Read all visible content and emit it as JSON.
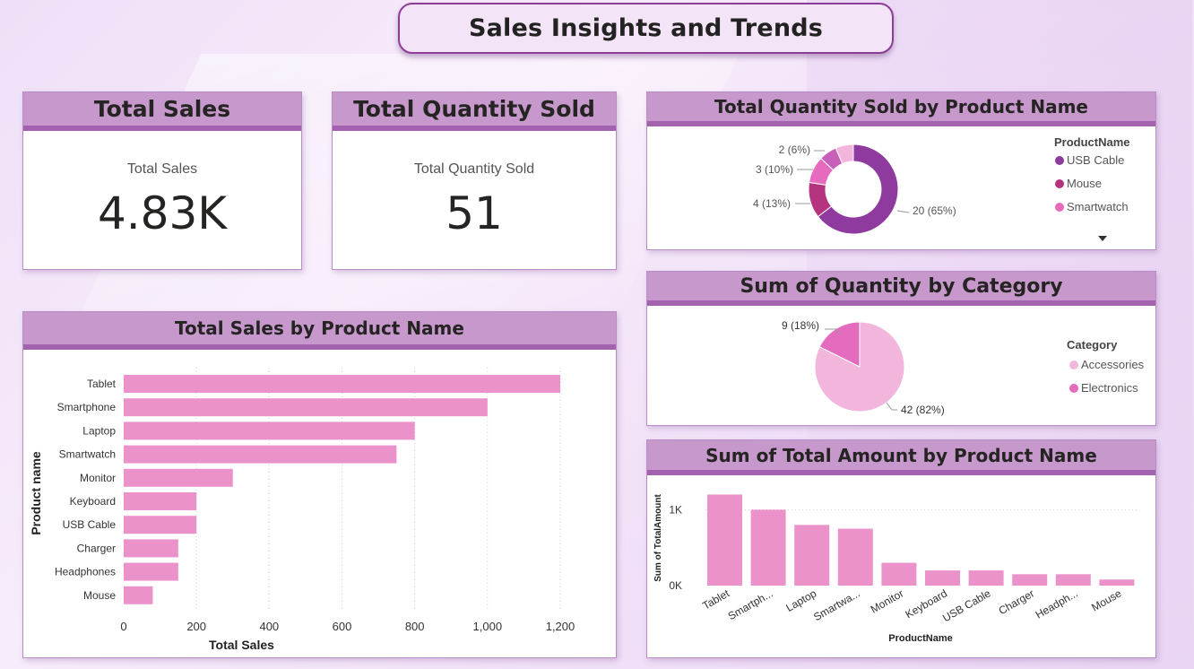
{
  "title": "Sales Insights and Trends",
  "colors": {
    "bar": "#ec92cb",
    "usb": "#8e3a9e",
    "mouse": "#b5347f",
    "smartwatch": "#e66bbf",
    "c4": "#c85fb8",
    "c5": "#f2b6dc",
    "accessories": "#f2b6dc",
    "electronics": "#e46bbd",
    "header": "#c698cc",
    "header_border": "#a262ad"
  },
  "kpis": {
    "sales": {
      "header": "Total Sales",
      "label": "Total Sales",
      "value": "4.83K"
    },
    "qty": {
      "header": "Total Quantity Sold",
      "label": "Total Quantity Sold",
      "value": "51"
    }
  },
  "chart_data": [
    {
      "id": "donut",
      "type": "pie",
      "title": "Total Quantity Sold by Product Name",
      "legend_title": "ProductName",
      "legend_items": [
        "USB Cable",
        "Mouse",
        "Smartwatch"
      ],
      "values": [
        20,
        4,
        3,
        2,
        2
      ],
      "data_labels": [
        "20 (65%)",
        "4 (13%)",
        "3 (10%)",
        "2 (6%)",
        ""
      ],
      "legend_position": "right",
      "more_icon": "caret-down-icon"
    },
    {
      "id": "pie",
      "type": "pie",
      "title": "Sum of Quantity by Category",
      "legend_title": "Category",
      "categories": [
        "Accessories",
        "Electronics"
      ],
      "values": [
        42,
        9
      ],
      "data_labels": [
        "42 (82%)",
        "9 (18%)"
      ],
      "legend_position": "right"
    },
    {
      "id": "hbar",
      "type": "bar",
      "orientation": "horizontal",
      "title": "Total Sales by Product Name",
      "categories": [
        "Tablet",
        "Smartphone",
        "Laptop",
        "Smartwatch",
        "Monitor",
        "Keyboard",
        "USB Cable",
        "Charger",
        "Headphones",
        "Mouse"
      ],
      "values": [
        1200,
        1000,
        800,
        750,
        300,
        200,
        200,
        150,
        150,
        80
      ],
      "xlabel": "Total Sales",
      "ylabel": "Product name",
      "xlim": [
        0,
        1200
      ],
      "ticks": [
        0,
        200,
        400,
        600,
        800,
        1000,
        1200
      ],
      "tick_labels": [
        "0",
        "200",
        "400",
        "600",
        "800",
        "1,000",
        "1,200"
      ],
      "grid": true
    },
    {
      "id": "vbar",
      "type": "bar",
      "orientation": "vertical",
      "title": "Sum of Total Amount by Product Name",
      "categories": [
        "Tablet",
        "Smartph...",
        "Laptop",
        "Smartwa...",
        "Monitor",
        "Keyboard",
        "USB Cable",
        "Charger",
        "Headph...",
        "Mouse"
      ],
      "values": [
        1200,
        1000,
        800,
        750,
        300,
        200,
        200,
        150,
        150,
        80
      ],
      "xlabel": "ProductName",
      "ylabel": "Sum of TotalAmount",
      "ylim": [
        0,
        1300
      ],
      "ticks": [
        0,
        1000
      ],
      "tick_labels": [
        "0K",
        "1K"
      ],
      "grid": true
    }
  ]
}
